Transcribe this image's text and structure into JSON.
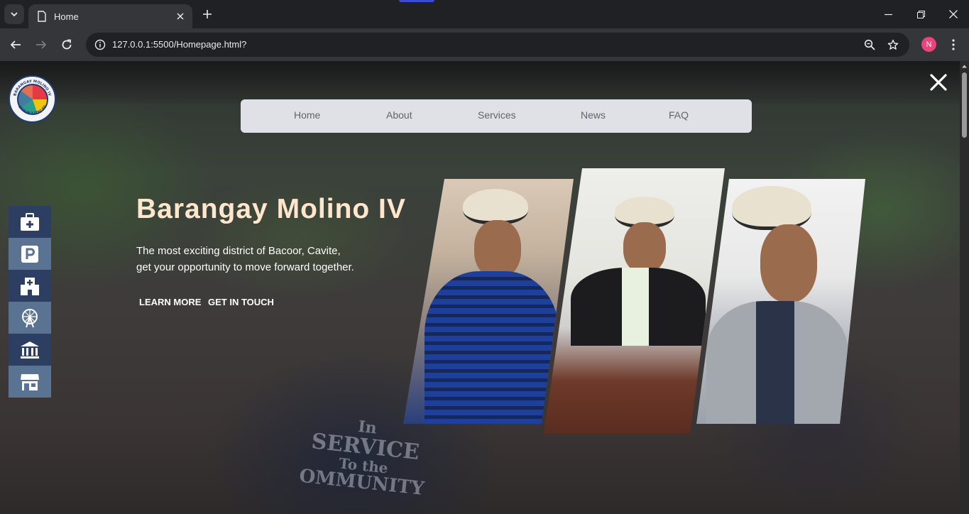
{
  "browser": {
    "tab_title": "Home",
    "url": "127.0.0.1:5500/Homepage.html?",
    "profile_initial": "N"
  },
  "page": {
    "logo": {
      "ring_text_top": "BARANGAY MOLINO IV",
      "ring_text_bottom": "GROUP 2 ITEC 63"
    },
    "nav": {
      "items": [
        "Home",
        "About",
        "Services",
        "News",
        "FAQ"
      ]
    },
    "hero": {
      "title": "Barangay Molino IV",
      "subtitle_line1": "The most exciting district of Bacoor, Cavite,",
      "subtitle_line2": "get your opportunity to move forward together.",
      "learn_more": "LEARN MORE",
      "get_in_touch": "GET IN TOUCH"
    },
    "side_icons": [
      "briefcase-medical-icon",
      "parking-icon",
      "hospital-icon",
      "ferris-wheel-icon",
      "bank-icon",
      "store-icon"
    ],
    "background_text": {
      "line1": "In",
      "line2": "SERVICE",
      "line3": "To the",
      "line4": "OMMUNITY"
    }
  },
  "colors": {
    "nav_bg": "#dfe1e7",
    "hero_title": "#ffe6cc",
    "side_dark": "#2c3e62",
    "side_light": "#5b7392"
  }
}
